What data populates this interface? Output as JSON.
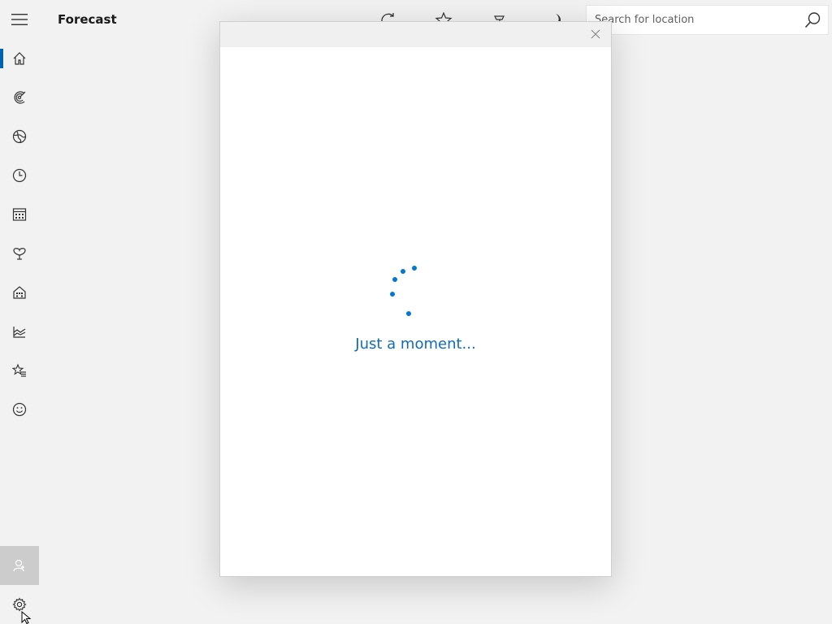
{
  "app": {
    "title": "Forecast"
  },
  "nav": {
    "items": [
      {
        "name": "home-icon",
        "active": true
      },
      {
        "name": "maps-icon"
      },
      {
        "name": "globe-icon"
      },
      {
        "name": "historical-weather-icon"
      },
      {
        "name": "monthly-forecast-icon"
      },
      {
        "name": "news-icon"
      },
      {
        "name": "places-icon"
      },
      {
        "name": "graph-icon"
      },
      {
        "name": "favorites-icon"
      },
      {
        "name": "feedback-icon"
      }
    ],
    "bottom": [
      {
        "name": "account-icon",
        "highlighted": true
      },
      {
        "name": "settings-icon"
      }
    ]
  },
  "commands": [
    "refresh-icon",
    "favorite-icon",
    "pin-icon",
    "night-mode-icon"
  ],
  "search": {
    "placeholder": "Search for location",
    "value": ""
  },
  "dialog": {
    "loading_text": "Just a moment..."
  },
  "colors": {
    "accent": "#0078d4",
    "loading_text": "#0f6cbd",
    "background": "#f2f2f2"
  }
}
